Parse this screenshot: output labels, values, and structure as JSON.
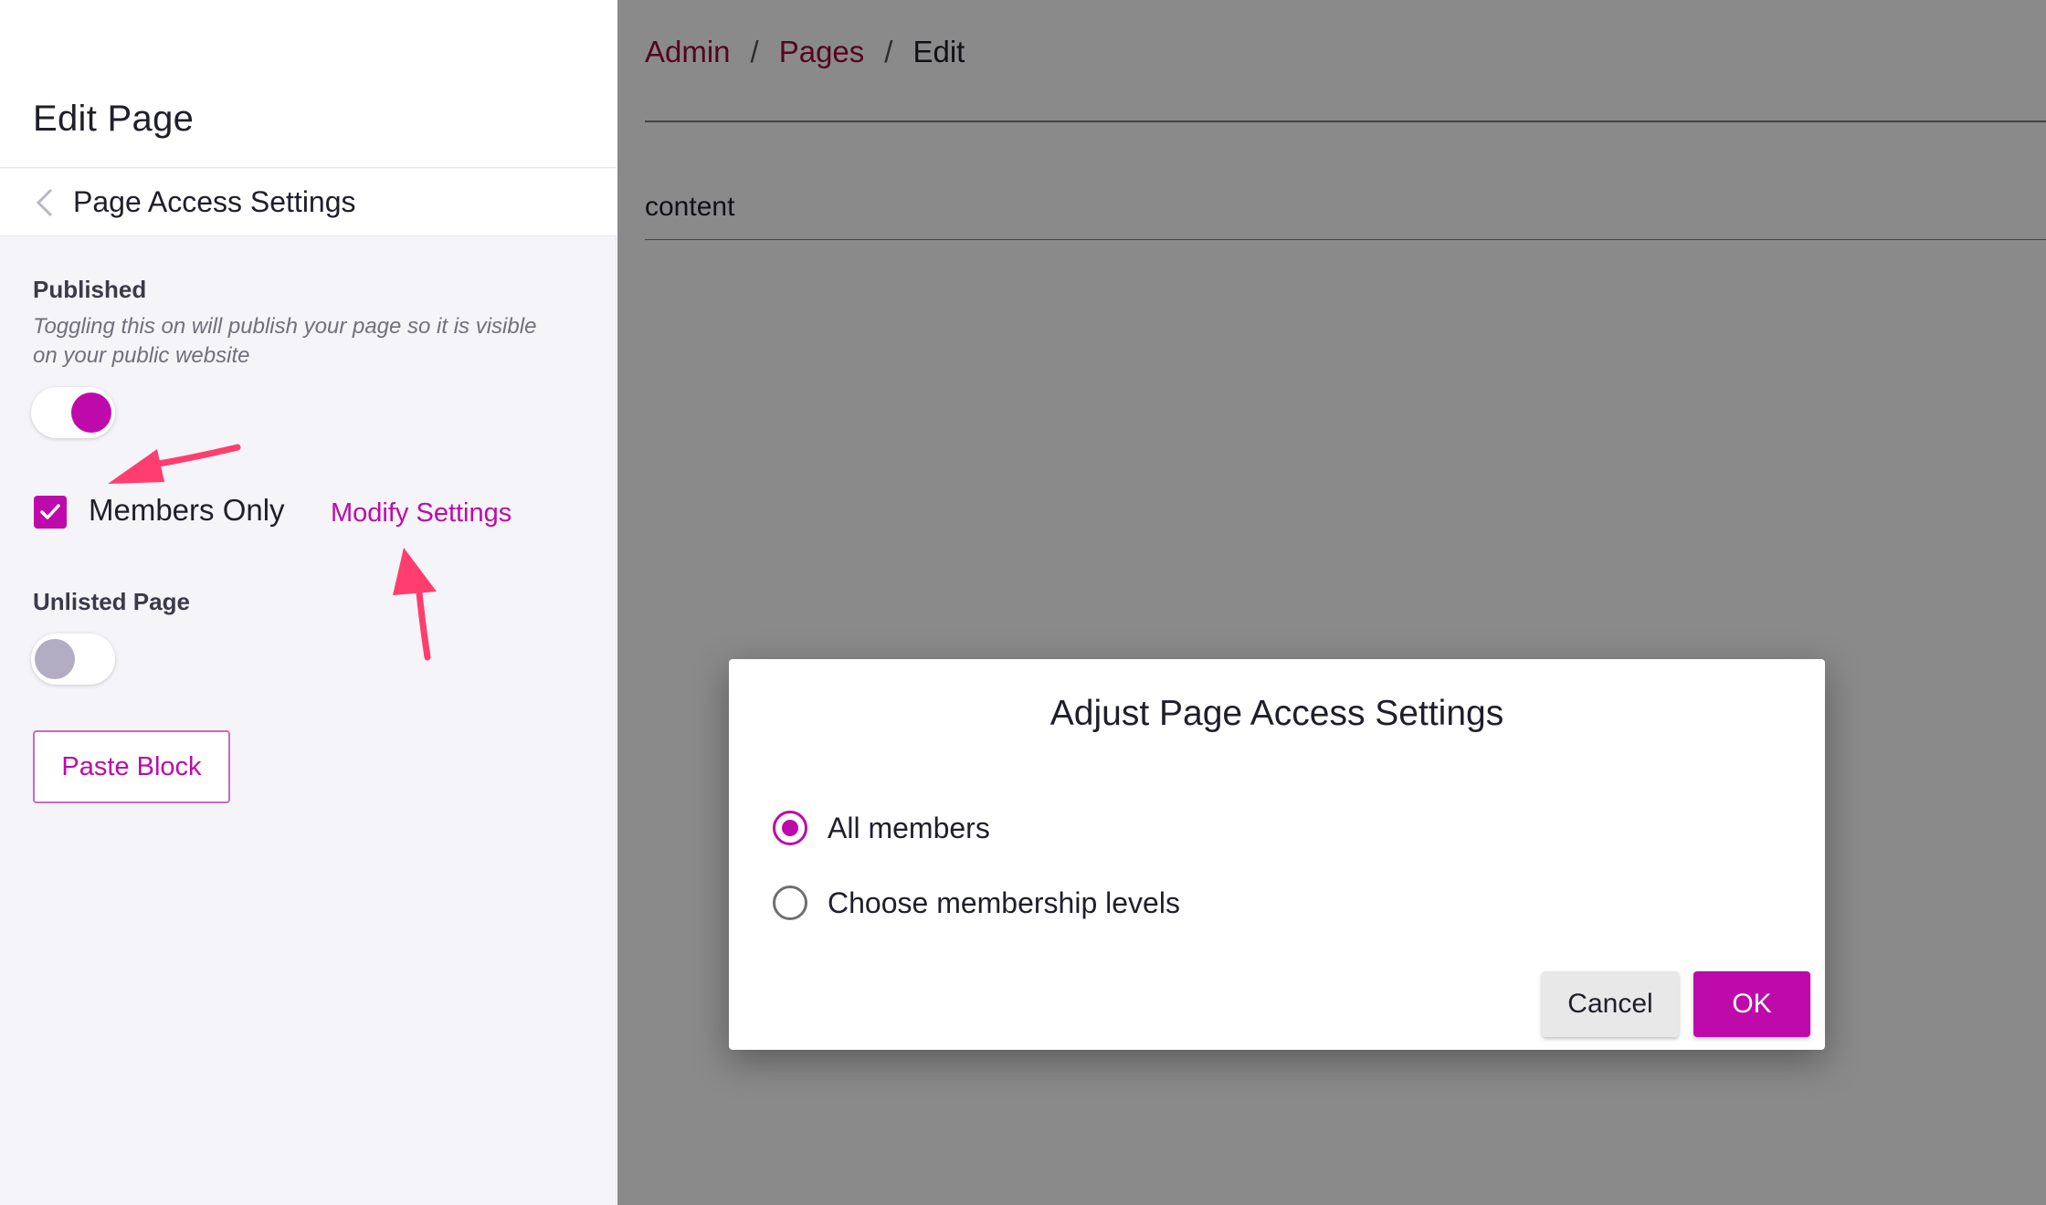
{
  "sidebar": {
    "title": "Edit Page",
    "subtitle": "Page Access Settings",
    "published": {
      "label": "Published",
      "help": "Toggling this on will publish your page so it is visible on your public website",
      "enabled": true
    },
    "members_only": {
      "label": "Members Only",
      "checked": true,
      "link_label": "Modify Settings"
    },
    "unlisted": {
      "label": "Unlisted Page",
      "enabled": false
    },
    "paste_block_label": "Paste Block"
  },
  "breadcrumb": {
    "items": [
      "Admin",
      "Pages"
    ],
    "separator": "/",
    "current": "Edit"
  },
  "main": {
    "content_label": "content"
  },
  "dialog": {
    "title": "Adjust Page Access Settings",
    "options": [
      {
        "label": "All members",
        "selected": true
      },
      {
        "label": "Choose membership levels",
        "selected": false
      }
    ],
    "cancel_label": "Cancel",
    "ok_label": "OK"
  },
  "colors": {
    "accent": "#be0aaa",
    "breadcrumb_link": "#9c0a3d",
    "annotation_arrow": "#ff3d6e"
  },
  "icons": {
    "back": "chevron-left-icon",
    "check": "check-icon"
  }
}
